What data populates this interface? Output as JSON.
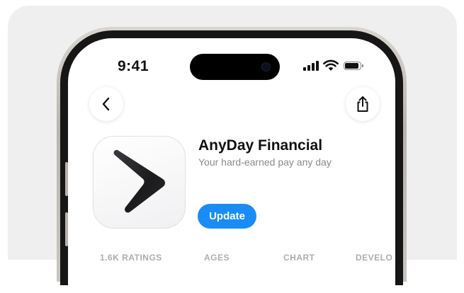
{
  "status_bar": {
    "time": "9:41"
  },
  "nav": {
    "back_icon": "chevron-left-icon",
    "share_icon": "share-icon"
  },
  "app": {
    "name": "AnyDay Financial",
    "subtitle": "Your hard-earned pay any day",
    "update_label": "Update",
    "icon": "arrow-chevron-logo",
    "accent_color": "#1a8cf7"
  },
  "stats": [
    {
      "label": "1.6K RATINGS"
    },
    {
      "label": "AGES"
    },
    {
      "label": "CHART"
    },
    {
      "label": "DEVELO"
    }
  ]
}
